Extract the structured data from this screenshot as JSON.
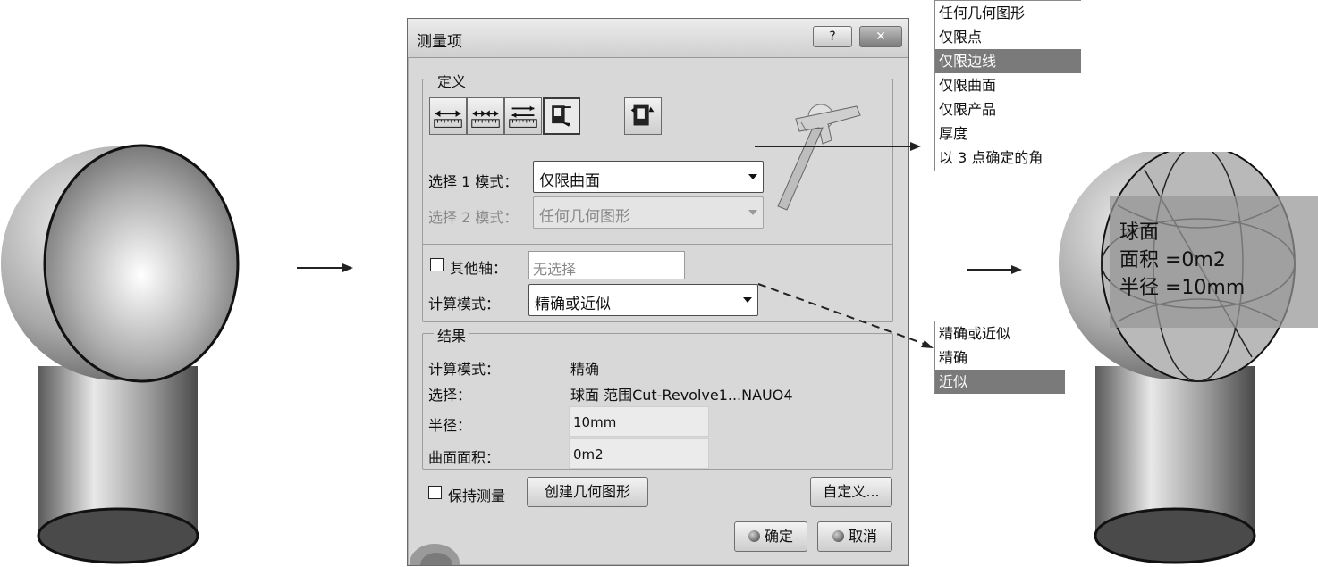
{
  "dialog": {
    "title": "测量项",
    "help_label": "?",
    "close_label": "✕",
    "definition": {
      "group_label": "定义",
      "mode_buttons": [
        "measure-between-icon",
        "measure-item-icon",
        "measure-thickness-icon",
        "measure-item-active-icon",
        "measure-extra-icon"
      ],
      "select1_label": "选择 1 模式：",
      "select1_value": "仅限曲面",
      "select2_label": "选择 2 模式：",
      "select2_value": "任何几何图形",
      "other_axis_label": "其他轴：",
      "other_axis_placeholder": "无选择",
      "calc_mode_label": "计算模式：",
      "calc_mode_value": "精确或近似"
    },
    "results": {
      "group_label": "结果",
      "calc_mode_label": "计算模式：",
      "calc_mode_value": "精确",
      "selection_label": "选择：",
      "selection_value": "球面 范围Cut-Revolve1...NAUO4",
      "radius_label": "半径：",
      "radius_value": "10mm",
      "area_label": "曲面面积：",
      "area_value": "0m2"
    },
    "keep_measure_label": "保持测量",
    "create_geometry_label": "创建几何图形",
    "customize_label": "自定义...",
    "ok_label": "确定",
    "cancel_label": "取消"
  },
  "selection_mode_list": {
    "items": [
      "任何几何图形",
      "仅限点",
      "仅限边线",
      "仅限曲面",
      "仅限产品",
      "厚度",
      "以 3 点确定的角"
    ],
    "highlighted": "仅限边线"
  },
  "calc_mode_list": {
    "items": [
      "精确或近似",
      "精确",
      "近似"
    ],
    "highlighted": "近似"
  },
  "overlay": {
    "name": "球面",
    "area": "面积 =0m2",
    "radius": "半径 =10mm"
  }
}
